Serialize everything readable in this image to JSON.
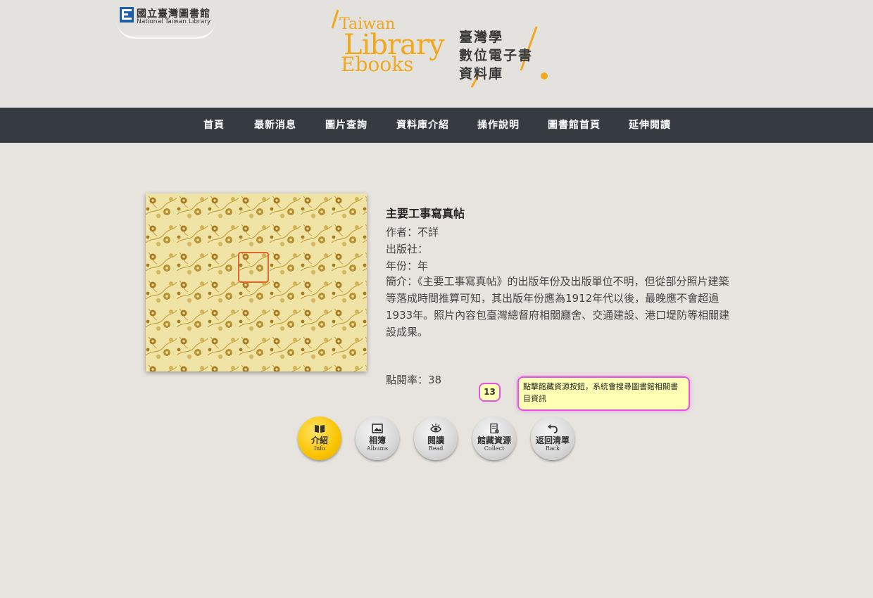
{
  "header": {
    "library_logo": {
      "name_zh": "國立臺灣圖書館",
      "name_en": "National Taiwan Library"
    },
    "site_logo": {
      "en_line1": "Taiwan",
      "en_line2": "Library",
      "en_line3": "Ebooks",
      "zh_line1": "臺灣學",
      "zh_line2": "數位電子書",
      "zh_line3": "資料庫"
    }
  },
  "nav": {
    "items": [
      {
        "label": "首頁"
      },
      {
        "label": "最新消息"
      },
      {
        "label": "圖片查詢"
      },
      {
        "label": "資料庫介紹"
      },
      {
        "label": "操作說明"
      },
      {
        "label": "圖書館首頁"
      },
      {
        "label": "延伸閱讀"
      }
    ]
  },
  "book": {
    "title": "主要工事寫真帖",
    "author": "作者：不詳",
    "publisher": "出版社：",
    "year": "年份：年",
    "description": "簡介：《主要工事寫真帖》的出版年份及出版單位不明，但從部分照片建築等落成時間推算可知，其出版年份應為1912年代以後，最晚應不會超過1933年。照片內容包臺灣總督府相關廳舍、交通建設、港口堤防等相關建設成果。",
    "views": "點閱率：38"
  },
  "annotation": {
    "step": "13",
    "tooltip": "點擊館藏資源按鈕，系統會搜尋圖書館相關書目資訊"
  },
  "actions": [
    {
      "label_zh": "介紹",
      "label_en": "Info",
      "icon": "book-icon",
      "active": true
    },
    {
      "label_zh": "相簿",
      "label_en": "Albums",
      "icon": "image-icon",
      "active": false
    },
    {
      "label_zh": "閱讀",
      "label_en": "Read",
      "icon": "eye-icon",
      "active": false
    },
    {
      "label_zh": "館藏資源",
      "label_en": "Collect",
      "icon": "document-icon",
      "active": false
    },
    {
      "label_zh": "返回清單",
      "label_en": "Back",
      "icon": "back-arrow-icon",
      "active": false
    }
  ],
  "colors": {
    "background": "#e7e4df",
    "nav_bar": "#363a41",
    "brand_orange": "#f1a81d",
    "active_button": "#f9c400",
    "annotation_border": "#e84fe3",
    "annotation_fill": "#ffffb3"
  }
}
